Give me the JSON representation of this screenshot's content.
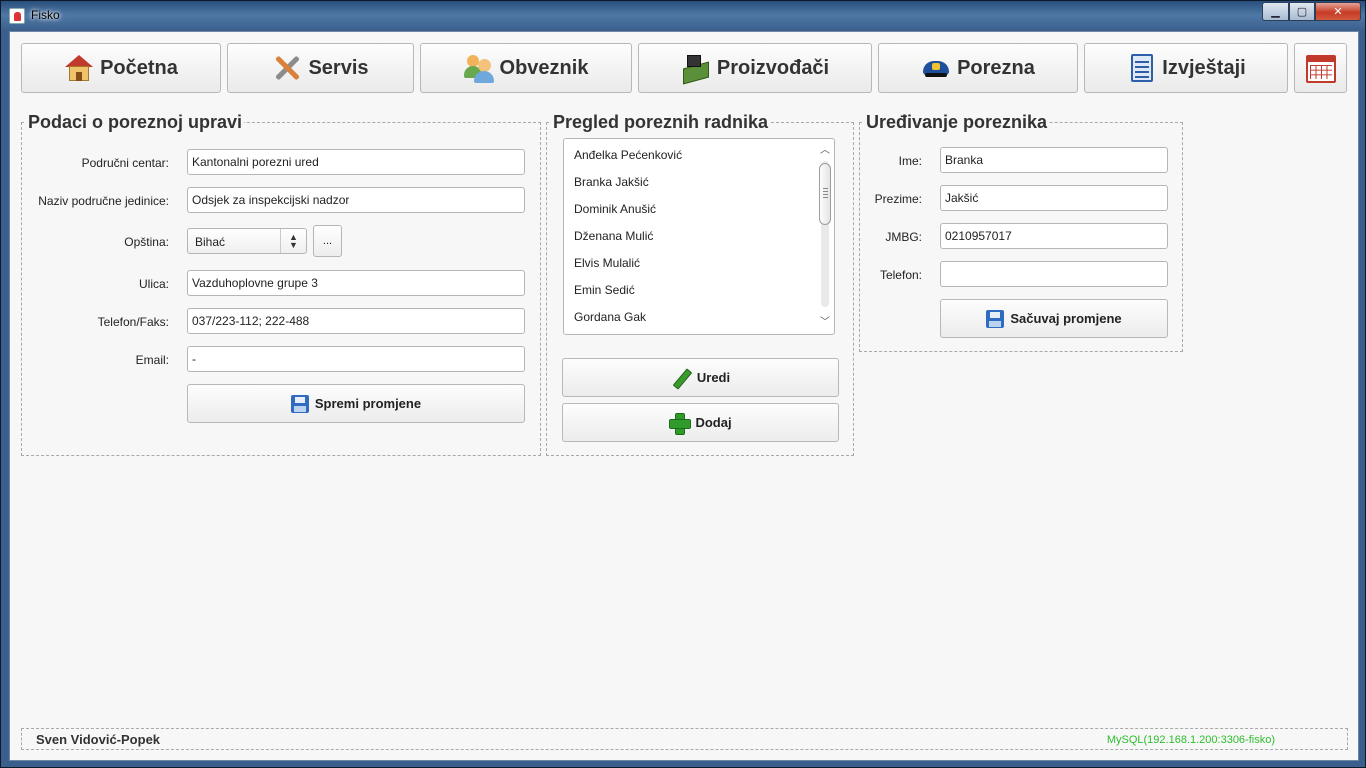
{
  "window": {
    "title": "Fisko",
    "min_label": "▁",
    "max_label": "▢",
    "close_label": "✕"
  },
  "nav": {
    "items": [
      {
        "label": "Početna",
        "icon": "house-icon"
      },
      {
        "label": "Servis",
        "icon": "tools-icon"
      },
      {
        "label": "Obveznik",
        "icon": "users-icon"
      },
      {
        "label": "Proizvođači",
        "icon": "factory-icon"
      },
      {
        "label": "Porezna",
        "icon": "police-cap-icon"
      },
      {
        "label": "Izvještaji",
        "icon": "report-icon"
      }
    ],
    "calendar_icon": "calendar-icon"
  },
  "tax_office": {
    "title": "Podaci o poreznoj upravi",
    "fields": {
      "regional_center": {
        "label": "Područni centar:",
        "value": "Kantonalni porezni ured"
      },
      "unit_name": {
        "label": "Naziv područne jedinice:",
        "value": "Odsjek za inspekcijski nadzor"
      },
      "municipality": {
        "label": "Opština:",
        "value": "Bihać",
        "browse_label": "..."
      },
      "street": {
        "label": "Ulica:",
        "value": "Vazduhoplovne grupe 3"
      },
      "phone_fax": {
        "label": "Telefon/Faks:",
        "value": "037/223-112; 222-488"
      },
      "email": {
        "label": "Email:",
        "value": "-"
      }
    },
    "save_label": "Spremi promjene"
  },
  "workers": {
    "title": "Pregled poreznih radnika",
    "items": [
      "Anđelka Pećenković",
      "Branka Jakšić",
      "Dominik Anušić",
      "Dženana Mulić",
      "Elvis Mulalić",
      "Emin Sedić",
      "Gordana Gak"
    ],
    "edit_label": "Uredi",
    "add_label": "Dodaj"
  },
  "editor": {
    "title": "Uređivanje poreznika",
    "fields": {
      "first_name": {
        "label": "Ime:",
        "value": "Branka"
      },
      "last_name": {
        "label": "Prezime:",
        "value": "Jakšić"
      },
      "jmbg": {
        "label": "JMBG:",
        "value": "0210957017"
      },
      "phone": {
        "label": "Telefon:",
        "value": ""
      }
    },
    "save_label": "Sačuvaj promjene"
  },
  "status": {
    "user": "Sven Vidović-Popek",
    "connection": "MySQL(192.168.1.200:3306-fisko)",
    "connection_color": "#2ebd2e"
  }
}
